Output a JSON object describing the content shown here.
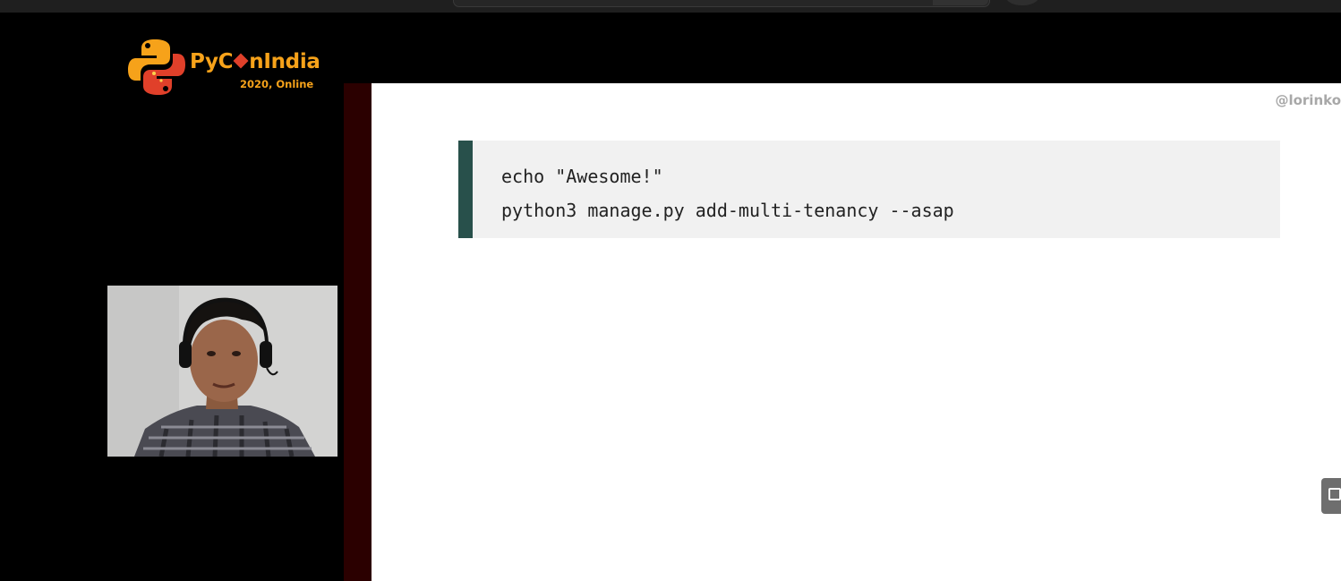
{
  "logo": {
    "name_parts": [
      "PyC",
      "n",
      "India"
    ],
    "subtitle": "2020, Online",
    "brand_color": "#f6a21a",
    "mark_colors": [
      "#f6a21a",
      "#e0402a"
    ]
  },
  "slide": {
    "handle": "@lorinko",
    "code_lines": [
      "echo \"Awesome!\"",
      "python3 manage.py add-multi-tenancy --asap"
    ],
    "code_accent_color": "#28504b"
  },
  "webcam": {
    "icon": "presenter-video-feed"
  },
  "controls": {
    "exit_icon": "exit-fullscreen-icon"
  }
}
